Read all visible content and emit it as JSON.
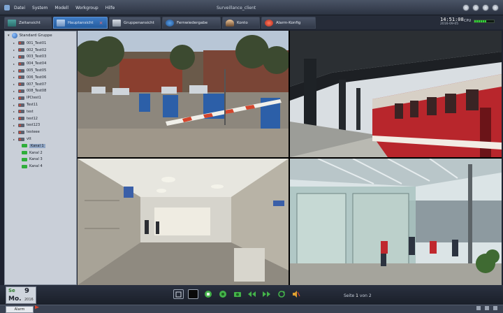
{
  "window": {
    "title": "Surveillance_client"
  },
  "menu": [
    "Datei",
    "System",
    "Modell",
    "Workgroup",
    "Hilfe"
  ],
  "tabs": [
    {
      "label": "Zeitansicht",
      "active": false,
      "icon": "monitor-icon"
    },
    {
      "label": "Hauptansicht",
      "active": true,
      "icon": "camera-view-icon"
    },
    {
      "label": "Gruppenansicht",
      "active": false,
      "icon": "group-icon"
    },
    {
      "label": "Fernwiedergabe",
      "active": false,
      "icon": "playback-icon"
    },
    {
      "label": "Konto",
      "active": false,
      "icon": "user-icon"
    },
    {
      "label": "Alarm-Konfig",
      "active": false,
      "icon": "alarm-icon"
    }
  ],
  "clock": {
    "time": "14:51:08",
    "date": "2016-09-05",
    "cpu_label": "CPU",
    "cpu_percent": 60
  },
  "tree": {
    "root": "Standard Gruppe",
    "devices": [
      "001_Test01",
      "002_Test02",
      "003_Test03",
      "004_Test04",
      "005_Test05",
      "006_Test06",
      "007_Test07",
      "008_Test08",
      "IPCtest1",
      "Test11",
      "test",
      "test12",
      "test123",
      "testeee",
      "vtt"
    ],
    "cameras": [
      {
        "label": "Kanal 1",
        "selected": true
      },
      {
        "label": "Kanal 2",
        "selected": false
      },
      {
        "label": "Kanal 3",
        "selected": false
      },
      {
        "label": "Kanal 4",
        "selected": false
      }
    ]
  },
  "date_widget": {
    "day_label": "Mo.",
    "day_top": "Se",
    "day_number": "9",
    "year": "2016"
  },
  "controls": [
    "fit-screen-icon",
    "fullscreen-icon",
    "record-icon",
    "snapshot-icon",
    "camera-icon",
    "rewind-icon",
    "forward-icon",
    "refresh-icon",
    "mute-icon"
  ],
  "pager": {
    "prefix": "Seite",
    "page": "1",
    "sep": "von",
    "total": "2"
  },
  "status": {
    "alarm_tab": "Alarm"
  },
  "colors": {
    "accent": "#2f6fb8",
    "sidebar": "#c9cfd8",
    "cpu": "#36d13c"
  }
}
